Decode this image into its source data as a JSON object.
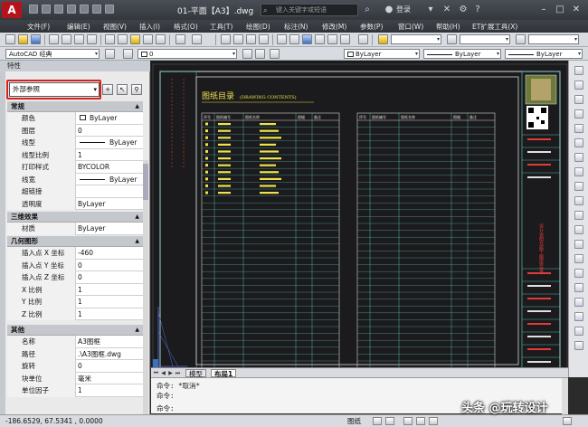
{
  "title_bar": {
    "logo": "A",
    "doc_title": "01-平面【A3】.dwg",
    "search_placeholder": "键入关键字或短语",
    "login_label": "登录",
    "icons": [
      "search-icon",
      "user-icon",
      "exchange-icon",
      "help-icon"
    ]
  },
  "menu": {
    "items": [
      "文件(F)",
      "编辑(E)",
      "视图(V)",
      "插入(I)",
      "格式(O)",
      "工具(T)",
      "绘图(D)",
      "标注(N)",
      "修改(M)",
      "参数(P)",
      "窗口(W)",
      "帮助(H)",
      "ET扩展工具(X)"
    ]
  },
  "toolbar2": {
    "workspace": "AutoCAD 经典",
    "layer_value": "0",
    "color_value": "ByLayer",
    "linetype_value": "ByLayer",
    "lineweight_value": "ByLayer"
  },
  "palette": {
    "title": "特性",
    "selector": "外部参照",
    "sections": {
      "general": {
        "title": "常规",
        "rows": [
          {
            "k": "颜色",
            "v": "ByLayer"
          },
          {
            "k": "图层",
            "v": "0"
          },
          {
            "k": "线型",
            "v": "ByLayer"
          },
          {
            "k": "线型比例",
            "v": "1"
          },
          {
            "k": "打印样式",
            "v": "BYCOLOR"
          },
          {
            "k": "线宽",
            "v": "ByLayer"
          },
          {
            "k": "超链接",
            "v": ""
          },
          {
            "k": "透明度",
            "v": "ByLayer"
          }
        ]
      },
      "three_d": {
        "title": "三维效果",
        "rows": [
          {
            "k": "材质",
            "v": "ByLayer"
          }
        ]
      },
      "geometry": {
        "title": "几何图形",
        "rows": [
          {
            "k": "插入点 X 坐标",
            "v": "-460"
          },
          {
            "k": "插入点 Y 坐标",
            "v": "0"
          },
          {
            "k": "插入点 Z 坐标",
            "v": "0"
          },
          {
            "k": "X 比例",
            "v": "1"
          },
          {
            "k": "Y 比例",
            "v": "1"
          },
          {
            "k": "Z 比例",
            "v": "1"
          }
        ]
      },
      "misc": {
        "title": "其他",
        "rows": [
          {
            "k": "名称",
            "v": "A3图框"
          },
          {
            "k": "路径",
            "v": ".\\A3图框.dwg"
          },
          {
            "k": "旋转",
            "v": "0"
          },
          {
            "k": "块单位",
            "v": "毫米"
          },
          {
            "k": "单位因子",
            "v": "1"
          }
        ]
      }
    }
  },
  "drawing": {
    "sheet_title": "图纸目录",
    "sheet_title_en": "(DRAWING CONTENTS)",
    "left_headers": [
      "序号",
      "图纸编号",
      "图纸名称",
      "图幅",
      "备注"
    ],
    "right_headers": [
      "序号",
      "图纸编号",
      "图纸名称",
      "图幅",
      "备注"
    ],
    "entry_count": 11,
    "right_table_label": "设计说明及施工图纸目录"
  },
  "tabs": {
    "model": "模型",
    "layout": "布局1"
  },
  "command": {
    "line1": "命令: *取消*",
    "line2": "命令:",
    "line3": "命令:"
  },
  "status": {
    "coords": "-186.6529, 67.5341 , 0.0000",
    "paper": "图纸"
  },
  "watermark": "头条 @玩转设计",
  "colors": {
    "title_bg": "#33373d",
    "canvas_bg": "#1b1b1d",
    "sheet_line": "#d8d8d8",
    "cyan_line": "#5fd3c9",
    "yellow_text": "#f0e24a",
    "highlight_border": "#d2231f"
  }
}
